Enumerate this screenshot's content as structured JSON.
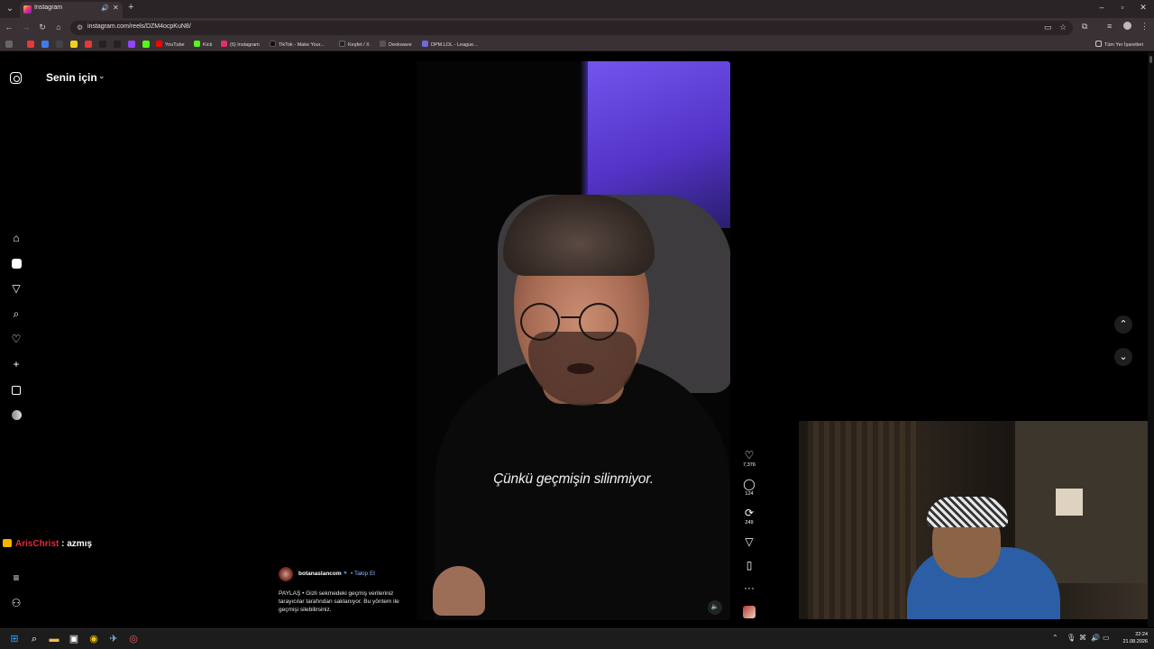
{
  "browser": {
    "tab_title": "Instagram",
    "url": "instagram.com/reels/DZM4ocpKuN8/",
    "bookmarks": [
      {
        "label": "YouTube",
        "color": "#ff0000"
      },
      {
        "label": "Kick",
        "color": "#53fc18"
      },
      {
        "label": "(6) Instagram",
        "color": "#e1306c"
      },
      {
        "label": "TikTok - Make Your...",
        "color": "#111111"
      },
      {
        "label": "Keşfet / X",
        "color": "#222222"
      },
      {
        "label": "Deokwave",
        "color": "#555555"
      },
      {
        "label": "DPM.LOL - League...",
        "color": "#6f6bd8"
      }
    ],
    "all_bookmarks": "Tüm Yer İşaretleri"
  },
  "feed": {
    "title": "Senin için",
    "nav_icons": [
      "home-icon",
      "reels-icon",
      "send-icon",
      "search-icon",
      "heart-icon",
      "plus-icon",
      "dashboard-icon",
      "profile-icon"
    ]
  },
  "chat": {
    "user": "ArisChrist",
    "message": " : azmış"
  },
  "reel": {
    "subtitle": "Çünkü geçmişin silinmiyor.",
    "actions": {
      "likes": "7,376",
      "comments": "124",
      "reposts": "249"
    }
  },
  "caption": {
    "username": "botanaslancom",
    "follow": "• Takip Et",
    "text": "PAYLAŞ • Gizli sekmedeki geçmiş verileriniz tarayıcılar tarafından saklanıyor. Bu yöntem ile geçmişi silebilirsiniz."
  },
  "taskbar": {
    "time": "22:24",
    "date": "21.08.2026"
  },
  "colors": {
    "accent_chat_user": "#e22b35",
    "reel_background": "#6a4ae8"
  }
}
